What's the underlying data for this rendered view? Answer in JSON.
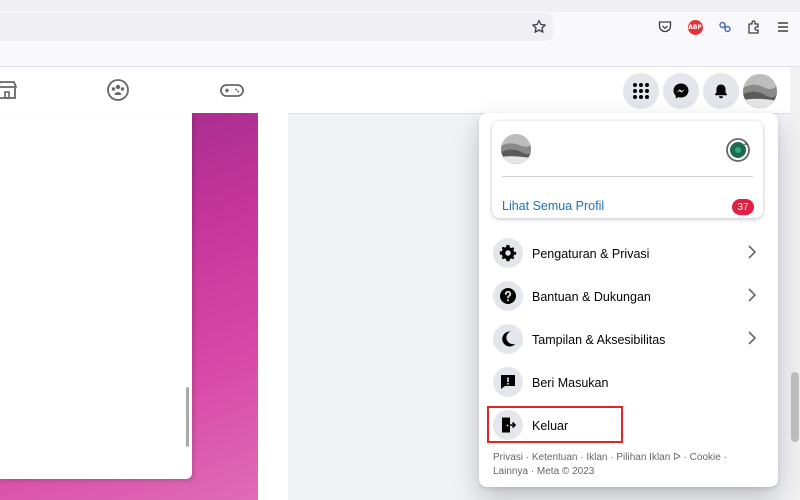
{
  "browser": {
    "icons": [
      "bookmark-star-icon",
      "pocket-icon",
      "adblock-plus-icon",
      "extension-link-icon",
      "extensions-icon",
      "menu-icon"
    ],
    "adblock_label": "ABP"
  },
  "header": {
    "nav_icons": [
      "marketplace-icon",
      "groups-icon",
      "gaming-icon"
    ],
    "right_icons": [
      "menu-grid-icon",
      "messenger-icon",
      "notifications-icon",
      "account-avatar"
    ]
  },
  "menu": {
    "see_all_profiles": "Lihat Semua Profil",
    "badge_count": "37",
    "items": [
      {
        "label": "Pengaturan & Privasi",
        "icon": "gear-icon",
        "chevron": true
      },
      {
        "label": "Bantuan & Dukungan",
        "icon": "help-icon",
        "chevron": true
      },
      {
        "label": "Tampilan & Aksesibilitas",
        "icon": "moon-icon",
        "chevron": true
      },
      {
        "label": "Beri Masukan",
        "icon": "feedback-icon",
        "chevron": false
      },
      {
        "label": "Keluar",
        "icon": "logout-icon",
        "chevron": false
      }
    ],
    "footer_line1": "Privasi · Ketentuan · Iklan · Pilihan Iklan ᐅ · Cookie ·",
    "footer_line2": "Lainnya · Meta © 2023"
  },
  "colors": {
    "accent_link": "#1a73b8",
    "badge": "#e41e3f",
    "highlight_box": "#e0262b"
  }
}
